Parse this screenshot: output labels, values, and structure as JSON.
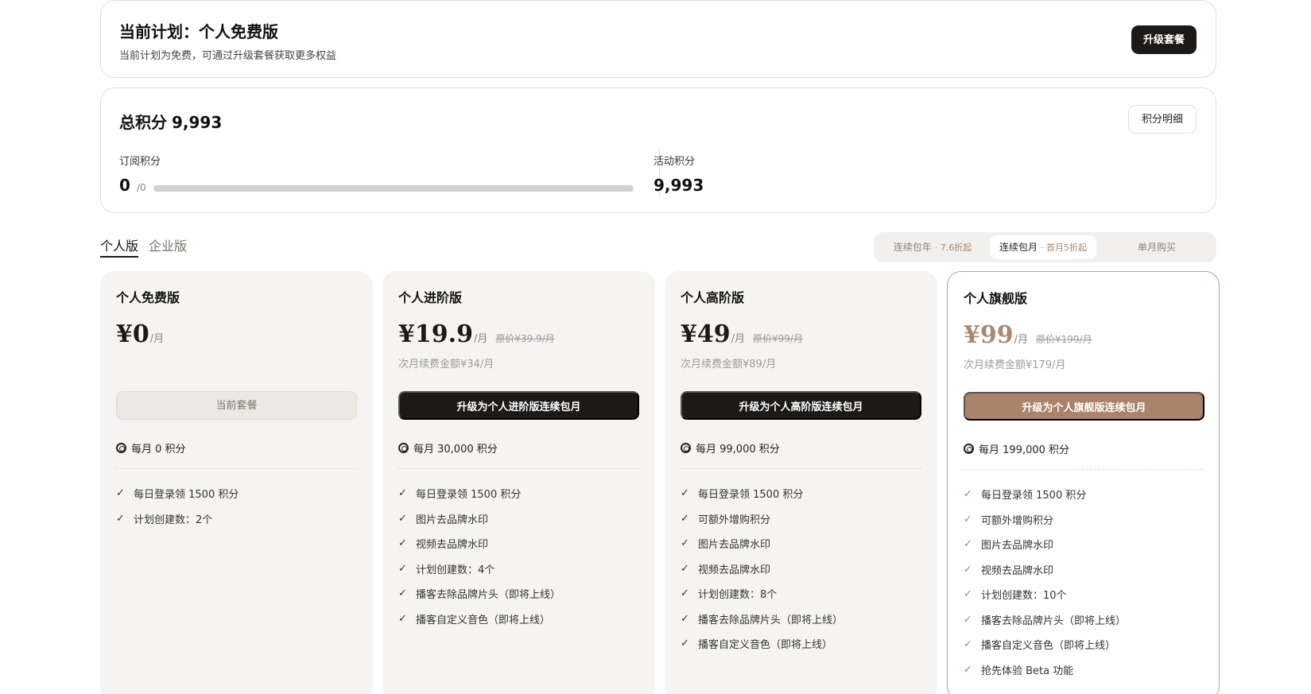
{
  "current_plan": {
    "title": "当前计划：个人免费版",
    "subtitle": "当前计划为免费，可通过升级套餐获取更多权益",
    "upgrade_label": "升级套餐"
  },
  "points": {
    "title_label": "总积分",
    "total": "9,993",
    "detail_label": "积分明细",
    "subscription_label": "订阅积分",
    "subscription_value": "0",
    "subscription_denom": "/0",
    "subscription_progress": 0,
    "activity_label": "活动积分",
    "activity_value": "9,993"
  },
  "tabs": [
    {
      "label": "个人版",
      "active": true
    },
    {
      "label": "企业版",
      "active": false
    }
  ],
  "billing": [
    {
      "label": "连续包年",
      "note": "· 7.6折起",
      "selected": false
    },
    {
      "label": "连续包月",
      "note": "· 首月5折起",
      "selected": true
    },
    {
      "label": "单月购买",
      "note": "",
      "selected": false
    }
  ],
  "plans": [
    {
      "name": "个人免费版",
      "price": "¥0",
      "per": "/月",
      "original": "",
      "renew": "",
      "cta": "当前套餐",
      "monthly": "每月 0 积分",
      "features": [
        "每日登录领 1500 积分",
        "计划创建数：2个"
      ]
    },
    {
      "name": "个人进阶版",
      "price": "¥19.9",
      "per": "/月",
      "original": "原价¥39.9/月",
      "renew": "次月续费金额¥34/月",
      "cta": "升级为个人进阶版连续包月",
      "monthly": "每月 30,000 积分",
      "features": [
        "每日登录领 1500 积分",
        "图片去品牌水印",
        "视频去品牌水印",
        "计划创建数：4个",
        "播客去除品牌片头（即将上线）",
        "播客自定义音色（即将上线）"
      ]
    },
    {
      "name": "个人高阶版",
      "price": "¥49",
      "per": "/月",
      "original": "原价¥99/月",
      "renew": "次月续费金额¥89/月",
      "cta": "升级为个人高阶版连续包月",
      "monthly": "每月 99,000 积分",
      "features": [
        "每日登录领 1500 积分",
        "可额外增购积分",
        "图片去品牌水印",
        "视频去品牌水印",
        "计划创建数：8个",
        "播客去除品牌片头（即将上线）",
        "播客自定义音色（即将上线）"
      ]
    },
    {
      "name": "个人旗舰版",
      "price": "¥99",
      "per": "/月",
      "original": "原价¥199/月",
      "renew": "次月续费金额¥179/月",
      "cta": "升级为个人旗舰版连续包月",
      "monthly": "每月 199,000 积分",
      "features": [
        "每日登录领 1500 积分",
        "可额外增购积分",
        "图片去品牌水印",
        "视频去品牌水印",
        "计划创建数：10个",
        "播客去除品牌片头（即将上线）",
        "播客自定义音色（即将上线）",
        "抢先体验 Beta 功能"
      ]
    }
  ],
  "colors": {
    "dark": "#1c1917",
    "accent_brown": "#a9836a",
    "card_bg": "#f5f4f2"
  }
}
